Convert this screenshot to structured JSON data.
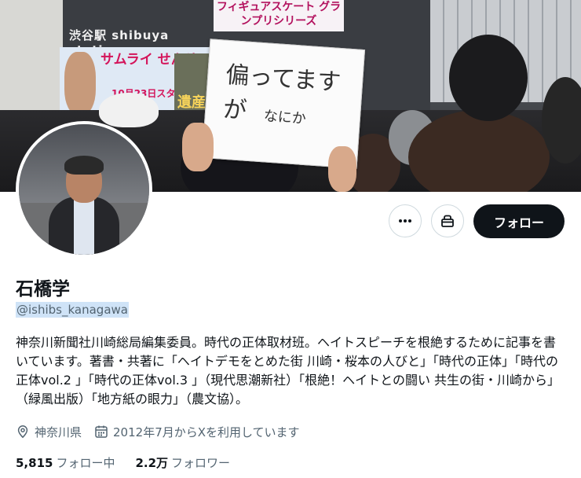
{
  "banner": {
    "station_sign": "渋谷駅 shibuya station",
    "top_ad": "フィギュアスケート グランプリシリーズ",
    "poster_title": "サムライ せんせい",
    "poster_date": "10月23日スタート! 11:15",
    "drama_title": "遺産",
    "sign_line1": "偏ってますが",
    "sign_line2": "なにか"
  },
  "actions": {
    "more_icon": "more-dots-icon",
    "gift_icon": "gift-icon",
    "follow_label": "フォロー"
  },
  "profile": {
    "name": "石橋学",
    "handle": "@ishibs_kanagawa",
    "bio": "神奈川新聞社川崎総局編集委員。時代の正体取材班。ヘイトスピーチを根絶するために記事を書いています。著書・共著に「ヘイトデモをとめた街 川崎・桜本の人びと」「時代の正体」「時代の正体vol.2 」「時代の正体vol.3 」（現代思潮新社）「根絶！ヘイトとの闘い 共生の街・川崎から」（緑風出版）「地方紙の眼力」（農文協）。",
    "location": "神奈川県",
    "joined": "2012年7月からXを利用しています"
  },
  "stats": {
    "following_count": "5,815",
    "following_label": "フォロー中",
    "followers_count": "2.2万",
    "followers_label": "フォロワー"
  },
  "colors": {
    "text_primary": "#0f1419",
    "text_secondary": "#536471",
    "follow_button_bg": "#0f1419",
    "button_border": "#cfd9de",
    "handle_highlight": "#cfe3f7"
  }
}
